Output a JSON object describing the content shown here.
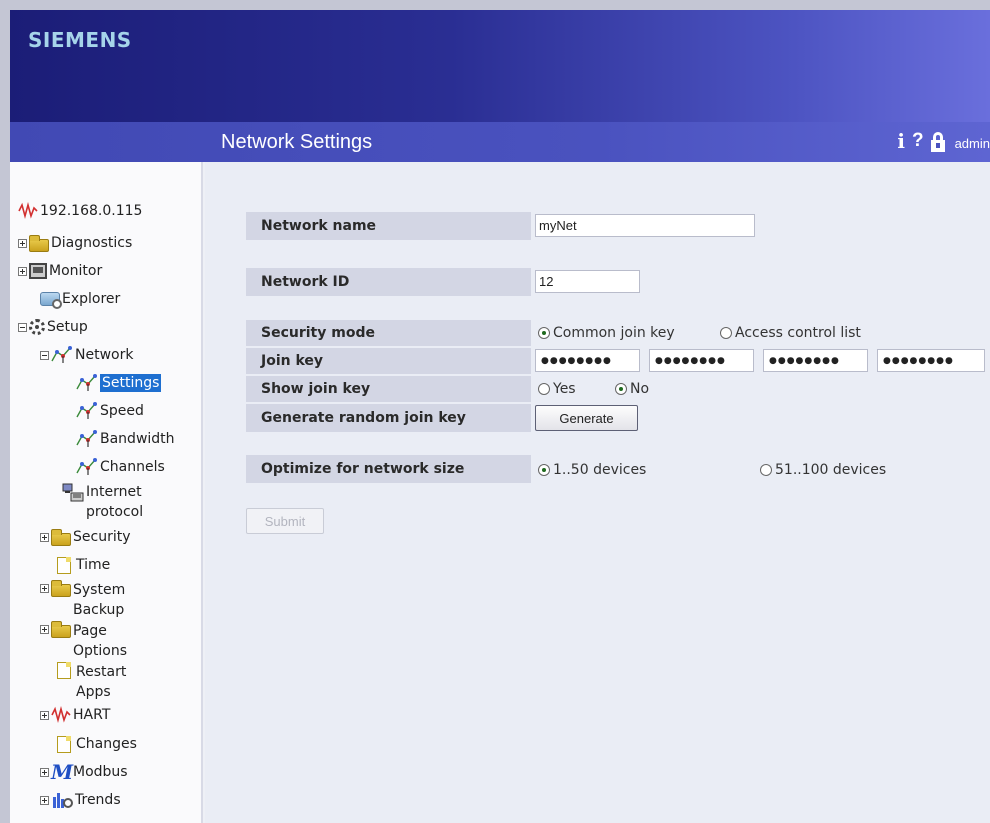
{
  "header": {
    "brand": "SIEMENS"
  },
  "titlebar": {
    "title": "Network Settings",
    "info": "i",
    "help": "?",
    "user": "admin"
  },
  "sidebar": {
    "root": "192.168.0.115",
    "items": {
      "diagnostics": "Diagnostics",
      "monitor": "Monitor",
      "explorer": "Explorer",
      "setup": "Setup",
      "network": "Network",
      "settings": "Settings",
      "speed": "Speed",
      "bandwidth": "Bandwidth",
      "channels": "Channels",
      "internet_protocol": "Internet protocol",
      "security": "Security",
      "time": "Time",
      "system_backup": "System Backup",
      "page_options": "Page Options",
      "restart_apps": "Restart Apps",
      "hart": "HART",
      "changes": "Changes",
      "modbus": "Modbus",
      "trends": "Trends"
    }
  },
  "form": {
    "network_name": {
      "label": "Network name",
      "value": "myNet"
    },
    "network_id": {
      "label": "Network ID",
      "value": "12"
    },
    "security_mode": {
      "label": "Security mode",
      "options": [
        "Common join key",
        "Access control list"
      ],
      "selected": "Common join key"
    },
    "join_key": {
      "label": "Join key",
      "parts": [
        "●●●●●●●●",
        "●●●●●●●●",
        "●●●●●●●●",
        "●●●●●●●●"
      ]
    },
    "show_join_key": {
      "label": "Show join key",
      "options": [
        "Yes",
        "No"
      ],
      "selected": "No"
    },
    "generate": {
      "label": "Generate random join key",
      "button": "Generate"
    },
    "optimize": {
      "label": "Optimize for network size",
      "options": [
        "1..50 devices",
        "51..100 devices"
      ],
      "selected": "1..50 devices"
    },
    "submit": "Submit"
  },
  "colors": {
    "header_dark": "#1b1d77",
    "header_light": "#6a6fdc",
    "titlebar": "#4a52bf",
    "label_bg": "#d3d6e4",
    "selected": "#1e6fd0"
  }
}
